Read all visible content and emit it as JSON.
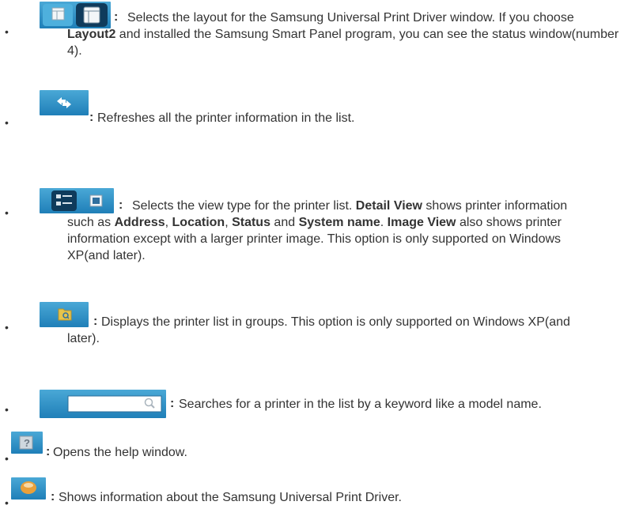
{
  "colors": {
    "button_blue": "#2a8cc4",
    "text": "#333333"
  },
  "items": [
    {
      "icons": [
        "layout1-icon",
        "layout2-icon"
      ],
      "segments": [
        {
          "t": "Selects the layout for the Samsung Universal Print Driver window. If you choose "
        },
        {
          "t": "Layout2",
          "b": true
        },
        {
          "t": " and installed the Samsung Smart Panel program, you can see the status window(number 4)."
        }
      ]
    },
    {
      "icons": [
        "refresh-icon"
      ],
      "segments": [
        {
          "t": "Refreshes all the printer information in the list."
        }
      ]
    },
    {
      "icons": [
        "detail-view-icon",
        "image-view-icon"
      ],
      "segments": [
        {
          "t": "Selects the view type for the printer list. "
        },
        {
          "t": "Detail View",
          "b": true
        },
        {
          "t": " shows printer information such as "
        },
        {
          "t": "Address",
          "b": true
        },
        {
          "t": ", "
        },
        {
          "t": "Location",
          "b": true
        },
        {
          "t": ", "
        },
        {
          "t": "Status",
          "b": true
        },
        {
          "t": " and "
        },
        {
          "t": "System name",
          "b": true
        },
        {
          "t": ". "
        },
        {
          "t": "Image View",
          "b": true
        },
        {
          "t": " also shows printer information except with a larger printer image. This option is only supported on Windows XP(and later)."
        }
      ]
    },
    {
      "icons": [
        "group-folder-icon"
      ],
      "segments": [
        {
          "t": "Displays the printer list in groups. This option is only supported on Windows XP(and later)."
        }
      ]
    },
    {
      "icons": [
        "search-box-icon"
      ],
      "segments": [
        {
          "t": "Searches for a printer in the list by a keyword like a model name."
        }
      ]
    },
    {
      "icons": [
        "help-icon"
      ],
      "segments": [
        {
          "t": "Opens the help window."
        }
      ]
    },
    {
      "icons": [
        "info-icon"
      ],
      "segments": [
        {
          "t": "Shows information about the Samsung Universal Print Driver."
        }
      ]
    }
  ]
}
